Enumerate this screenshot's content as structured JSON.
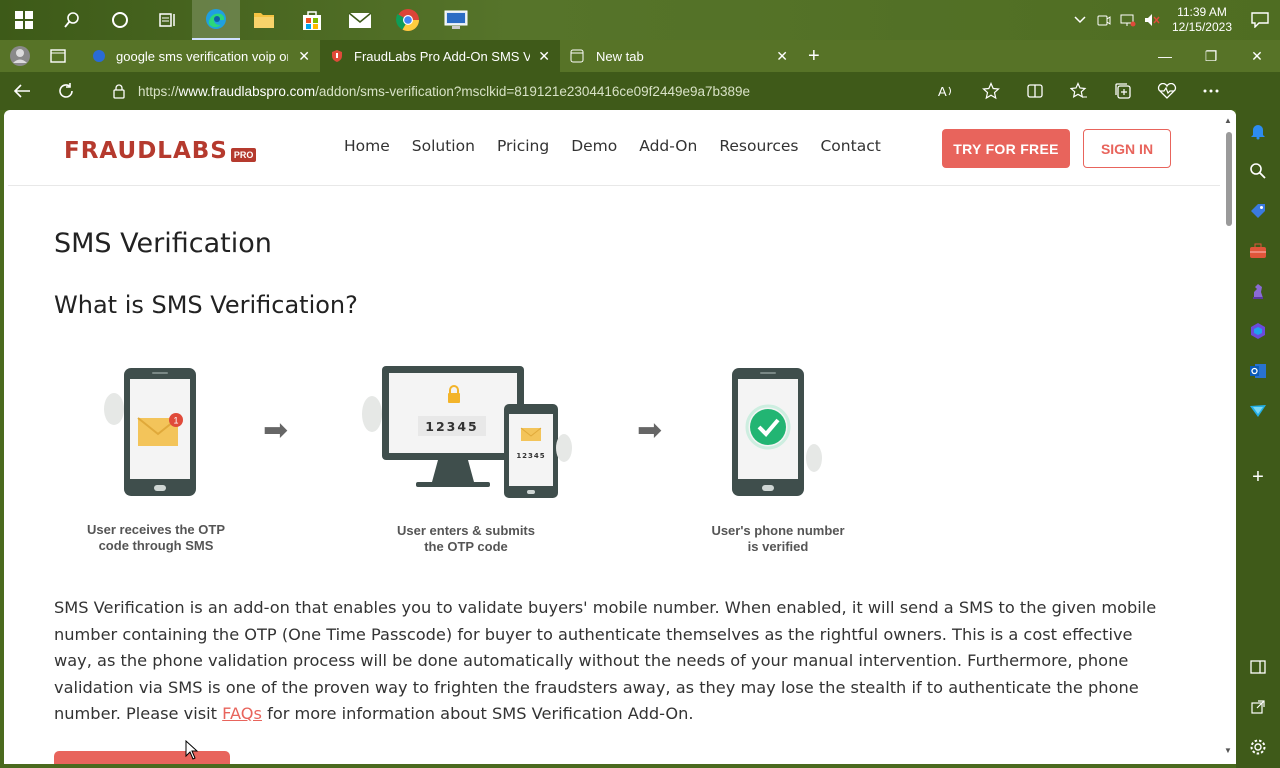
{
  "taskbar": {
    "clock_time": "11:39 AM",
    "clock_date": "12/15/2023",
    "apps": [
      "windows-icon",
      "search-icon",
      "cortana-icon",
      "task-view-icon",
      "edge-icon",
      "file-explorer-icon",
      "store-icon",
      "mail-icon",
      "chrome-icon",
      "remote-desktop-icon"
    ]
  },
  "tabs": [
    {
      "label": "google sms verification voip onli",
      "active": false
    },
    {
      "label": "FraudLabs Pro Add-On SMS Verif",
      "active": true
    },
    {
      "label": "New tab",
      "active": false
    }
  ],
  "address": {
    "prefix": "https://",
    "host": "www.fraudlabspro.com",
    "path": "/addon/sms-verification?msclkid=819121e2304416ce09f2449e9a7b389e"
  },
  "site": {
    "logo_text": "FRAUDLABS",
    "logo_badge": "PRO",
    "nav": [
      "Home",
      "Solution",
      "Pricing",
      "Demo",
      "Add-On",
      "Resources",
      "Contact"
    ],
    "try_label": "TRY FOR FREE",
    "sign_label": "SIGN IN",
    "brand_color": "#e8645c"
  },
  "content": {
    "title": "SMS Verification",
    "subtitle": "What is SMS Verification?",
    "steps": [
      {
        "line1": "User receives the OTP",
        "line2": "code through SMS"
      },
      {
        "line1": "User enters & submits",
        "line2": "the OTP code"
      },
      {
        "line1": "User's phone number",
        "line2": "is verified"
      }
    ],
    "otp_big": "12345",
    "otp_small": "12345",
    "notification_count": "1",
    "paragraph_before": "SMS Verification is an add-on that enables you to validate buyers' mobile number. When enabled, it will send a SMS to the given mobile number containing the OTP (One Time Passcode) for buyer to authenticate themselves as the rightful owners. This is a cost effective way, as the phone validation process will be done automatically without the needs of your manual intervention. Furthermore, phone validation via SMS is one of the proven way to frighten the fraudsters away, as they may lose the stealth if to authenticate the phone number. Please visit ",
    "paragraph_link": "FAQs",
    "paragraph_after": " for more information about SMS Verification Add-On."
  }
}
